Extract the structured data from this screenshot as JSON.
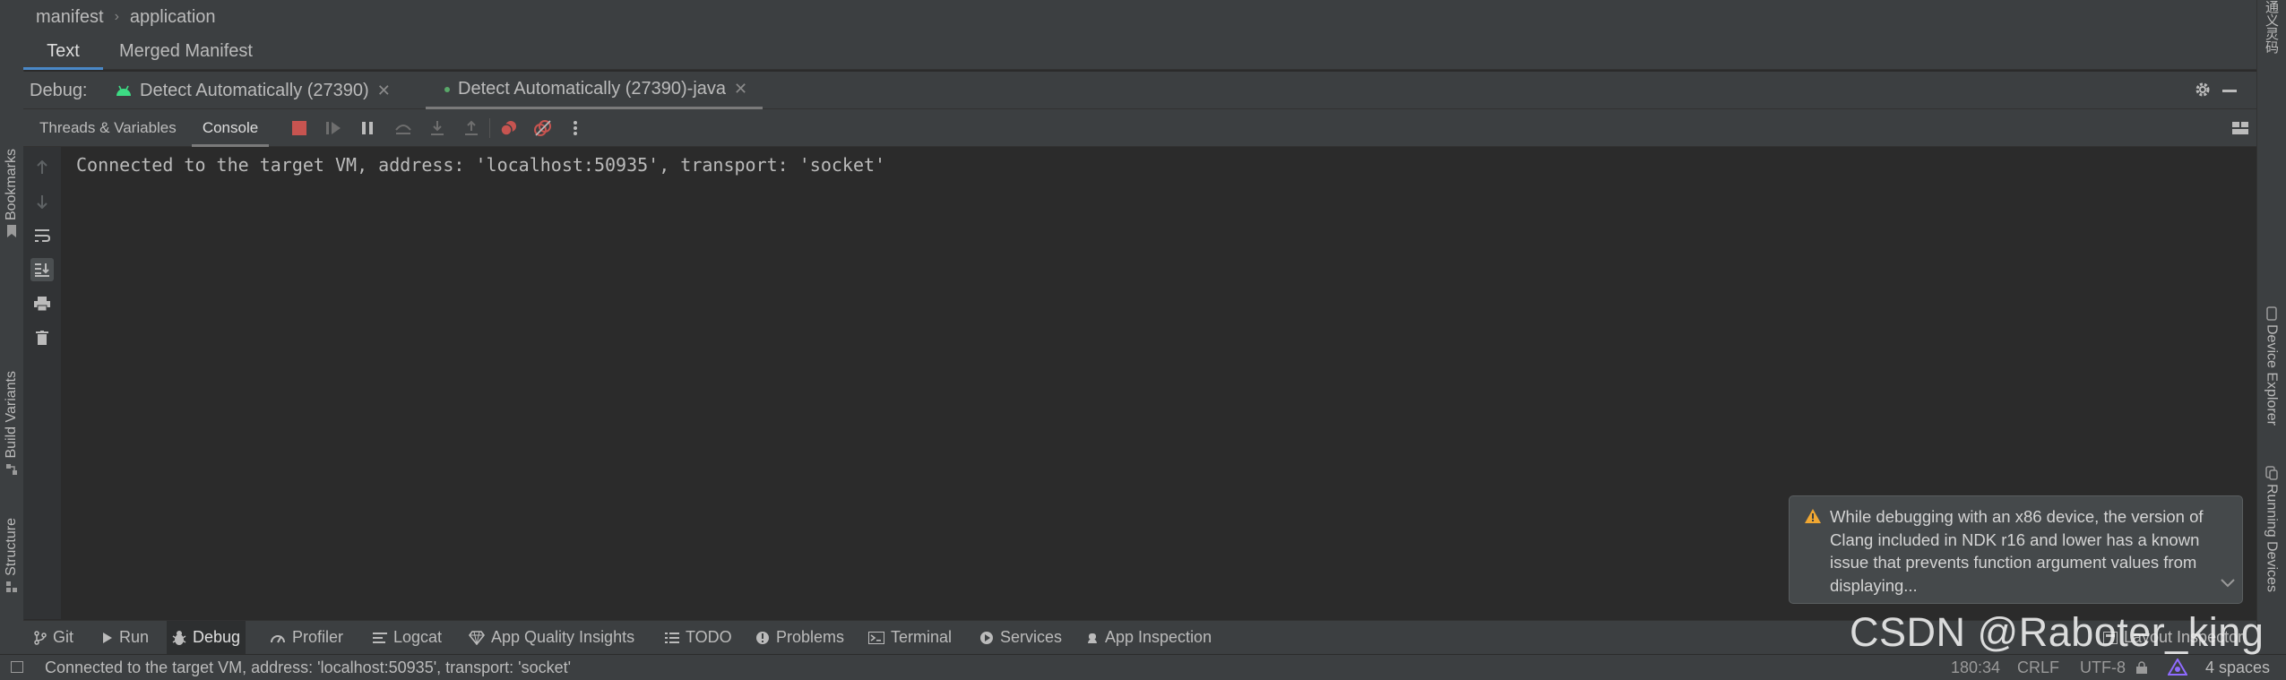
{
  "breadcrumb": {
    "items": [
      "manifest",
      "application"
    ]
  },
  "editor_tabs": [
    {
      "label": "Text",
      "active": true
    },
    {
      "label": "Merged Manifest",
      "active": false
    }
  ],
  "debug_panel": {
    "title": "Debug:",
    "tabs": [
      {
        "label": "Detect Automatically (27390)",
        "active": false,
        "icon": "android-icon"
      },
      {
        "label": "Detect Automatically (27390)-java",
        "active": true,
        "icon": "green-dot-icon"
      }
    ]
  },
  "debug_toolbar": {
    "tabs": [
      {
        "label": "Threads & Variables",
        "active": false
      },
      {
        "label": "Console",
        "active": true
      }
    ]
  },
  "console": {
    "lines": [
      "Connected to the target VM, address: 'localhost:50935', transport: 'socket'"
    ]
  },
  "left_stripe": {
    "bookmarks": "Bookmarks",
    "build_variants": "Build Variants",
    "structure": "Structure"
  },
  "right_stripe": {
    "panel_label": "通义灵码",
    "device_explorer": "Device Explorer",
    "running_devices": "Running Devices"
  },
  "notification": {
    "text": "While debugging with an x86 device, the version of Clang included in NDK r16 and lower has a known issue that prevents function argument values from displaying...",
    "icon": "warning-icon"
  },
  "bottom_tabs": [
    {
      "label": "Git",
      "icon": "git-branch-icon",
      "active": false
    },
    {
      "label": "Run",
      "icon": "play-icon",
      "active": false
    },
    {
      "label": "Debug",
      "icon": "bug-icon",
      "active": true
    },
    {
      "label": "Profiler",
      "icon": "gauge-icon",
      "active": false
    },
    {
      "label": "Logcat",
      "icon": "logcat-icon",
      "active": false
    },
    {
      "label": "App Quality Insights",
      "icon": "diamond-icon",
      "active": false
    },
    {
      "label": "TODO",
      "icon": "list-icon",
      "active": false
    },
    {
      "label": "Problems",
      "icon": "info-circle-icon",
      "active": false
    },
    {
      "label": "Terminal",
      "icon": "terminal-icon",
      "active": false
    },
    {
      "label": "Services",
      "icon": "services-icon",
      "active": false
    },
    {
      "label": "App Inspection",
      "icon": "inspection-icon",
      "active": false
    },
    {
      "label": "Layout Inspector",
      "icon": "layout-inspector-icon",
      "active": false
    }
  ],
  "status_bar": {
    "message": "Connected to the target VM, address: 'localhost:50935', transport: 'socket'",
    "position": "180:34",
    "line_separator": "CRLF",
    "encoding": "UTF-8",
    "indent": "4 spaces"
  },
  "watermark": "CSDN @Raboter_king",
  "colors": {
    "background": "#2b2b2b",
    "panel": "#3c3f41",
    "accent_blue": "#4a88c7",
    "stop_red": "#c75450",
    "android_green": "#3ddc84",
    "warning_orange": "#f0a732"
  }
}
